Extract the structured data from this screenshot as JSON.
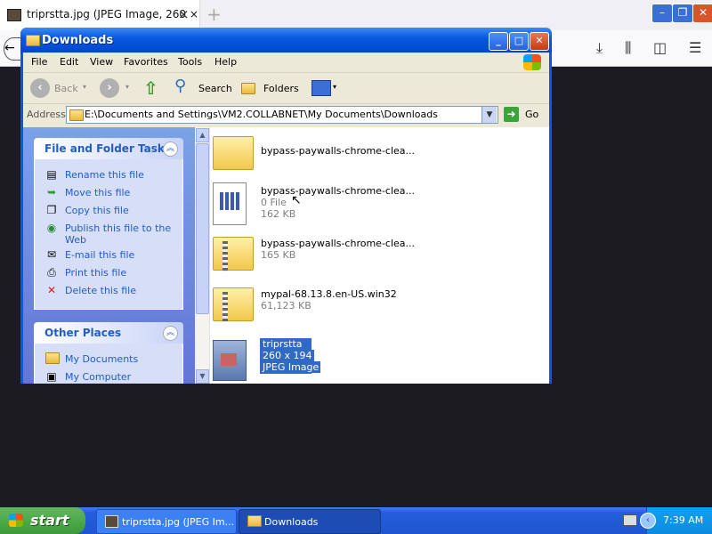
{
  "browser": {
    "tab_title": "triprstta.jpg (JPEG Image, 260 ×",
    "tab_close": "×",
    "new_tab": "+"
  },
  "window": {
    "title": "Downloads",
    "menu": [
      "File",
      "Edit",
      "View",
      "Favorites",
      "Tools",
      "Help"
    ],
    "toolbar": {
      "back": "Back",
      "search": "Search",
      "folders": "Folders"
    },
    "address_label": "Address",
    "address_value": "E:\\Documents and Settings\\VM2.COLLABNET\\My Documents\\Downloads",
    "go_label": "Go"
  },
  "tasks_panel": {
    "title": "File and Folder Tasks",
    "items": [
      {
        "label": "Rename this file",
        "icon": "rename-icon"
      },
      {
        "label": "Move this file",
        "icon": "move-icon"
      },
      {
        "label": "Copy this file",
        "icon": "copy-icon"
      },
      {
        "label": "Publish this file to the Web",
        "icon": "globe-icon"
      },
      {
        "label": "E-mail this file",
        "icon": "email-icon"
      },
      {
        "label": "Print this file",
        "icon": "print-icon"
      },
      {
        "label": "Delete this file",
        "icon": "delete-icon"
      }
    ]
  },
  "places_panel": {
    "title": "Other Places",
    "items": [
      {
        "label": "My Documents",
        "icon": "folder-icon"
      },
      {
        "label": "My Computer",
        "icon": "computer-icon"
      }
    ]
  },
  "files": [
    {
      "name": "bypass-paywalls-chrome-clea...",
      "line2": "",
      "line3": "",
      "type": "folder"
    },
    {
      "name": "bypass-paywalls-chrome-clea...",
      "line2": "0 File",
      "line3": "162 KB",
      "type": "file"
    },
    {
      "name": "bypass-paywalls-chrome-clea...",
      "line2": "165 KB",
      "line3": "",
      "type": "zip"
    },
    {
      "name": "mypal-68.13.8.en-US.win32",
      "line2": "61,123 KB",
      "line3": "",
      "type": "zip"
    },
    {
      "name": "triprstta",
      "line2": "260 x 194",
      "line3": "JPEG Image",
      "type": "image",
      "selected": true
    }
  ],
  "taskbar": {
    "start": "start",
    "buttons": [
      "triprstta.jpg (JPEG Im...",
      "Downloads"
    ],
    "clock": "7:39 AM"
  },
  "colors": {
    "xp_blue": "#0a57e0",
    "task_link": "#215dc6",
    "selection": "#316ac5"
  }
}
